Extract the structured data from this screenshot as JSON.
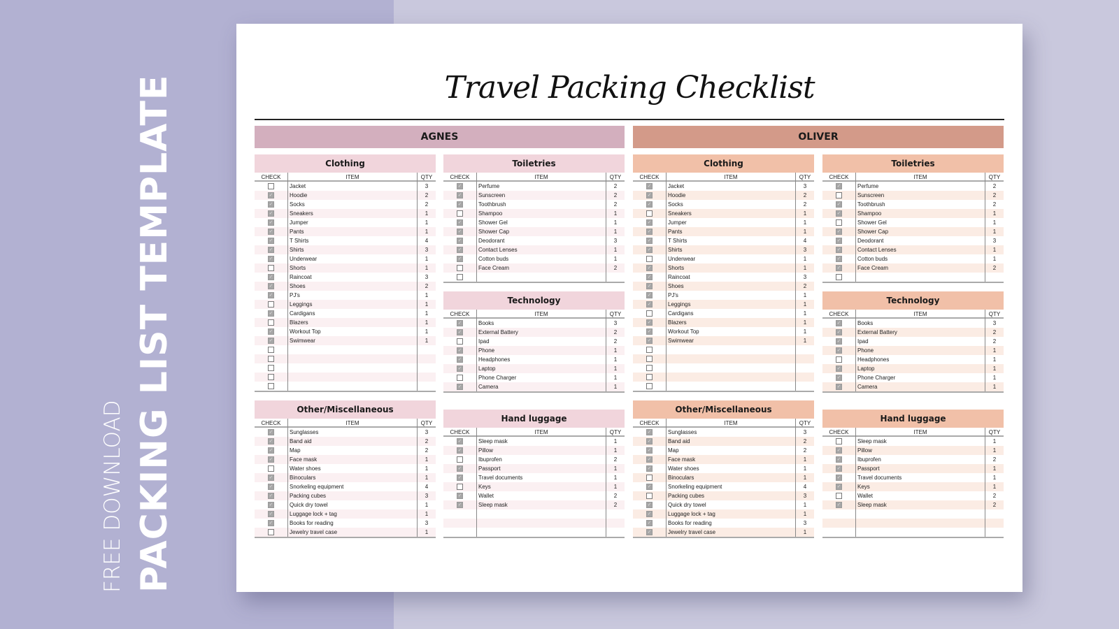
{
  "banner": {
    "line1": "FREE DOWNLOAD",
    "line2": "PACKING LIST TEMPLATE"
  },
  "document": {
    "title": "Travel Packing Checklist",
    "columns": {
      "check": "CHECK",
      "item": "ITEM",
      "qty": "QTY"
    },
    "colors": {
      "agnes_header": "#d3afbe",
      "agnes_section": "#f1d5dc",
      "oliver_header": "#d39a89",
      "oliver_section": "#f1c0a8",
      "checked_box": "#a6a6a6"
    },
    "people": [
      {
        "name": "AGNES",
        "sections": [
          {
            "title": "Clothing",
            "items": [
              {
                "item": "Jacket",
                "qty": "3",
                "checked": false
              },
              {
                "item": "Hoodie",
                "qty": "2",
                "checked": true
              },
              {
                "item": "Socks",
                "qty": "2",
                "checked": true
              },
              {
                "item": "Sneakers",
                "qty": "1",
                "checked": true
              },
              {
                "item": "Jumper",
                "qty": "1",
                "checked": true
              },
              {
                "item": "Pants",
                "qty": "1",
                "checked": true
              },
              {
                "item": "T Shirts",
                "qty": "4",
                "checked": true
              },
              {
                "item": "Shirts",
                "qty": "3",
                "checked": true
              },
              {
                "item": "Underwear",
                "qty": "1",
                "checked": true
              },
              {
                "item": "Shorts",
                "qty": "1",
                "checked": false
              },
              {
                "item": "Raincoat",
                "qty": "3",
                "checked": true
              },
              {
                "item": "Shoes",
                "qty": "2",
                "checked": true
              },
              {
                "item": "PJ's",
                "qty": "1",
                "checked": true
              },
              {
                "item": "Leggings",
                "qty": "1",
                "checked": false
              },
              {
                "item": "Cardigans",
                "qty": "1",
                "checked": true
              },
              {
                "item": "Blazers",
                "qty": "1",
                "checked": false
              },
              {
                "item": "Workout Top",
                "qty": "1",
                "checked": true
              },
              {
                "item": "Swimwear",
                "qty": "1",
                "checked": true
              },
              {
                "item": "",
                "qty": "",
                "checked": false
              },
              {
                "item": "",
                "qty": "",
                "checked": false
              },
              {
                "item": "",
                "qty": "",
                "checked": false
              },
              {
                "item": "",
                "qty": "",
                "checked": false
              },
              {
                "item": "",
                "qty": "",
                "checked": false
              }
            ]
          },
          {
            "title": "Toiletries",
            "items": [
              {
                "item": "Perfume",
                "qty": "2",
                "checked": true
              },
              {
                "item": "Sunscreen",
                "qty": "2",
                "checked": true
              },
              {
                "item": "Toothbrush",
                "qty": "2",
                "checked": true
              },
              {
                "item": "Shampoo",
                "qty": "1",
                "checked": false
              },
              {
                "item": "Shower Gel",
                "qty": "1",
                "checked": true
              },
              {
                "item": "Shower Cap",
                "qty": "1",
                "checked": true
              },
              {
                "item": "Deodorant",
                "qty": "3",
                "checked": true
              },
              {
                "item": "Contact Lenses",
                "qty": "1",
                "checked": true
              },
              {
                "item": "Cotton buds",
                "qty": "1",
                "checked": true
              },
              {
                "item": "Face Cream",
                "qty": "2",
                "checked": false
              },
              {
                "item": "",
                "qty": "",
                "checked": false
              }
            ]
          },
          {
            "title": "Technology",
            "items": [
              {
                "item": "Books",
                "qty": "3",
                "checked": true
              },
              {
                "item": "External Battery",
                "qty": "2",
                "checked": true
              },
              {
                "item": "Ipad",
                "qty": "2",
                "checked": false
              },
              {
                "item": "Phone",
                "qty": "1",
                "checked": true
              },
              {
                "item": "Headphones",
                "qty": "1",
                "checked": true
              },
              {
                "item": "Laptop",
                "qty": "1",
                "checked": true
              },
              {
                "item": "Phone Charger",
                "qty": "1",
                "checked": false
              },
              {
                "item": "Camera",
                "qty": "1",
                "checked": true
              }
            ]
          },
          {
            "title": "Other/Miscellaneous",
            "items": [
              {
                "item": "Sunglasses",
                "qty": "3",
                "checked": true
              },
              {
                "item": "Band aid",
                "qty": "2",
                "checked": true
              },
              {
                "item": "Map",
                "qty": "2",
                "checked": true
              },
              {
                "item": "Face mask",
                "qty": "1",
                "checked": true
              },
              {
                "item": "Water shoes",
                "qty": "1",
                "checked": false
              },
              {
                "item": "Binoculars",
                "qty": "1",
                "checked": true
              },
              {
                "item": "Snorkeling equipment",
                "qty": "4",
                "checked": true
              },
              {
                "item": "Packing cubes",
                "qty": "3",
                "checked": true
              },
              {
                "item": "Quick dry towel",
                "qty": "1",
                "checked": true
              },
              {
                "item": "Luggage lock + tag",
                "qty": "1",
                "checked": true
              },
              {
                "item": "Books for reading",
                "qty": "3",
                "checked": true
              },
              {
                "item": "Jewelry travel case",
                "qty": "1",
                "checked": false
              }
            ]
          },
          {
            "title": "Hand luggage",
            "items": [
              {
                "item": "Sleep mask",
                "qty": "1",
                "checked": true
              },
              {
                "item": "Pillow",
                "qty": "1",
                "checked": true
              },
              {
                "item": "Ibuprofen",
                "qty": "2",
                "checked": false
              },
              {
                "item": "Passport",
                "qty": "1",
                "checked": true
              },
              {
                "item": "Travel documents",
                "qty": "1",
                "checked": true
              },
              {
                "item": "Keys",
                "qty": "1",
                "checked": false
              },
              {
                "item": "Wallet",
                "qty": "2",
                "checked": true
              },
              {
                "item": "Sleep mask",
                "qty": "2",
                "checked": true
              },
              {
                "item": "",
                "qty": "",
                "checked": null
              },
              {
                "item": "",
                "qty": "",
                "checked": null
              },
              {
                "item": "",
                "qty": "",
                "checked": null
              }
            ]
          }
        ]
      },
      {
        "name": "OLIVER",
        "sections": [
          {
            "title": "Clothing",
            "items": [
              {
                "item": "Jacket",
                "qty": "3",
                "checked": true
              },
              {
                "item": "Hoodie",
                "qty": "2",
                "checked": true
              },
              {
                "item": "Socks",
                "qty": "2",
                "checked": true
              },
              {
                "item": "Sneakers",
                "qty": "1",
                "checked": false
              },
              {
                "item": "Jumper",
                "qty": "1",
                "checked": true
              },
              {
                "item": "Pants",
                "qty": "1",
                "checked": true
              },
              {
                "item": "T Shirts",
                "qty": "4",
                "checked": true
              },
              {
                "item": "Shirts",
                "qty": "3",
                "checked": true
              },
              {
                "item": "Underwear",
                "qty": "1",
                "checked": false
              },
              {
                "item": "Shorts",
                "qty": "1",
                "checked": true
              },
              {
                "item": "Raincoat",
                "qty": "3",
                "checked": true
              },
              {
                "item": "Shoes",
                "qty": "2",
                "checked": true
              },
              {
                "item": "PJ's",
                "qty": "1",
                "checked": true
              },
              {
                "item": "Leggings",
                "qty": "1",
                "checked": true
              },
              {
                "item": "Cardigans",
                "qty": "1",
                "checked": false
              },
              {
                "item": "Blazers",
                "qty": "1",
                "checked": true
              },
              {
                "item": "Workout Top",
                "qty": "1",
                "checked": true
              },
              {
                "item": "Swimwear",
                "qty": "1",
                "checked": true
              },
              {
                "item": "",
                "qty": "",
                "checked": false
              },
              {
                "item": "",
                "qty": "",
                "checked": false
              },
              {
                "item": "",
                "qty": "",
                "checked": false
              },
              {
                "item": "",
                "qty": "",
                "checked": false
              },
              {
                "item": "",
                "qty": "",
                "checked": false
              }
            ]
          },
          {
            "title": "Toiletries",
            "items": [
              {
                "item": "Perfume",
                "qty": "2",
                "checked": true
              },
              {
                "item": "Sunscreen",
                "qty": "2",
                "checked": false
              },
              {
                "item": "Toothbrush",
                "qty": "2",
                "checked": true
              },
              {
                "item": "Shampoo",
                "qty": "1",
                "checked": true
              },
              {
                "item": "Shower Gel",
                "qty": "1",
                "checked": false
              },
              {
                "item": "Shower Cap",
                "qty": "1",
                "checked": true
              },
              {
                "item": "Deodorant",
                "qty": "3",
                "checked": true
              },
              {
                "item": "Contact Lenses",
                "qty": "1",
                "checked": true
              },
              {
                "item": "Cotton buds",
                "qty": "1",
                "checked": true
              },
              {
                "item": "Face Cream",
                "qty": "2",
                "checked": true
              },
              {
                "item": "",
                "qty": "",
                "checked": false
              }
            ]
          },
          {
            "title": "Technology",
            "items": [
              {
                "item": "Books",
                "qty": "3",
                "checked": true
              },
              {
                "item": "External Battery",
                "qty": "2",
                "checked": true
              },
              {
                "item": "Ipad",
                "qty": "2",
                "checked": true
              },
              {
                "item": "Phone",
                "qty": "1",
                "checked": true
              },
              {
                "item": "Headphones",
                "qty": "1",
                "checked": false
              },
              {
                "item": "Laptop",
                "qty": "1",
                "checked": true
              },
              {
                "item": "Phone Charger",
                "qty": "1",
                "checked": true
              },
              {
                "item": "Camera",
                "qty": "1",
                "checked": true
              }
            ]
          },
          {
            "title": "Other/Miscellaneous",
            "items": [
              {
                "item": "Sunglasses",
                "qty": "3",
                "checked": true
              },
              {
                "item": "Band aid",
                "qty": "2",
                "checked": true
              },
              {
                "item": "Map",
                "qty": "2",
                "checked": true
              },
              {
                "item": "Face mask",
                "qty": "1",
                "checked": true
              },
              {
                "item": "Water shoes",
                "qty": "1",
                "checked": true
              },
              {
                "item": "Binoculars",
                "qty": "1",
                "checked": false
              },
              {
                "item": "Snorkeling equipment",
                "qty": "4",
                "checked": true
              },
              {
                "item": "Packing cubes",
                "qty": "3",
                "checked": false
              },
              {
                "item": "Quick dry towel",
                "qty": "1",
                "checked": true
              },
              {
                "item": "Luggage lock + tag",
                "qty": "1",
                "checked": true
              },
              {
                "item": "Books for reading",
                "qty": "3",
                "checked": true
              },
              {
                "item": "Jewelry travel case",
                "qty": "1",
                "checked": true
              }
            ]
          },
          {
            "title": "Hand luggage",
            "items": [
              {
                "item": "Sleep mask",
                "qty": "1",
                "checked": false
              },
              {
                "item": "Pillow",
                "qty": "1",
                "checked": true
              },
              {
                "item": "Ibuprofen",
                "qty": "2",
                "checked": true
              },
              {
                "item": "Passport",
                "qty": "1",
                "checked": true
              },
              {
                "item": "Travel documents",
                "qty": "1",
                "checked": true
              },
              {
                "item": "Keys",
                "qty": "1",
                "checked": true
              },
              {
                "item": "Wallet",
                "qty": "2",
                "checked": false
              },
              {
                "item": "Sleep mask",
                "qty": "2",
                "checked": true
              },
              {
                "item": "",
                "qty": "",
                "checked": null
              },
              {
                "item": "",
                "qty": "",
                "checked": null
              },
              {
                "item": "",
                "qty": "",
                "checked": null
              }
            ]
          }
        ]
      }
    ]
  }
}
